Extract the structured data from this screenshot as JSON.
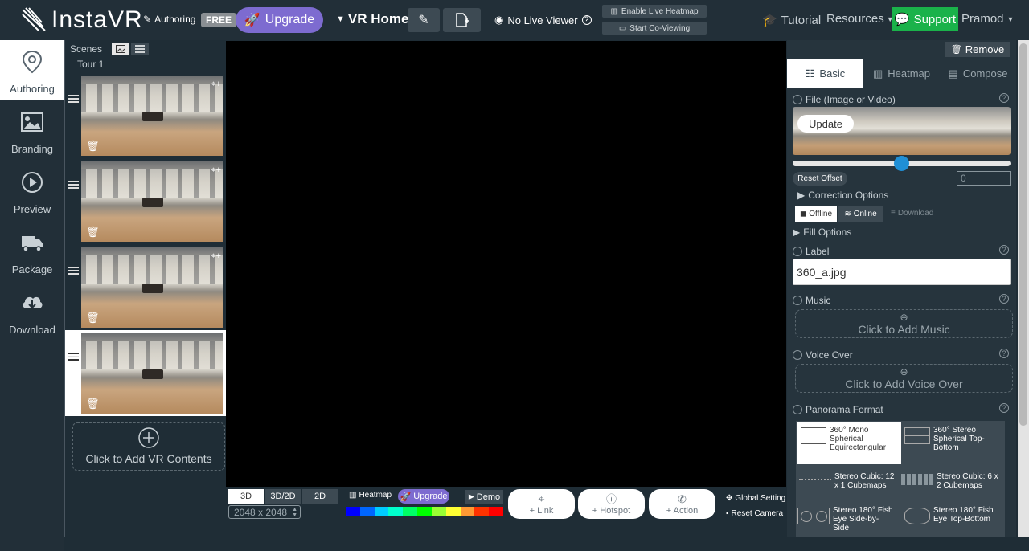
{
  "header": {
    "app_name": "InstaVR",
    "mode_label": "Authoring",
    "plan_badge": "FREE",
    "upgrade_label": "Upgrade",
    "project_title": "VR Home",
    "live_viewer": "No Live Viewer",
    "heatmap_label": "Enable Live Heatmap",
    "coview_label": "Start Co-Viewing",
    "tutorial_label": "Tutorial",
    "resources_label": "Resources",
    "support_label": "Support",
    "user_name": "Pramod"
  },
  "sidebar": {
    "items": [
      {
        "label": "Authoring",
        "icon": "map-pin-icon"
      },
      {
        "label": "Branding",
        "icon": "image-icon"
      },
      {
        "label": "Preview",
        "icon": "play-circle-icon"
      },
      {
        "label": "Package",
        "icon": "truck-icon"
      },
      {
        "label": "Download",
        "icon": "cloud-download-icon"
      }
    ]
  },
  "scenes": {
    "header_label": "Scenes",
    "tour_label": "Tour 1",
    "add_label": "Click to Add VR Contents"
  },
  "viewer": {
    "modes": [
      "3D",
      "3D/2D",
      "2D"
    ],
    "resolution": "2048 x 2048",
    "heatmap_label": "Heatmap",
    "upgrade_label": "Upgrade",
    "demo_label": "Demo",
    "link_label": "+ Link",
    "hotspot_label": "+ Hotspot",
    "action_label": "+ Action",
    "global_settings": "Global Setting",
    "reset_camera": "Reset Camera",
    "heat_colors": [
      "#0000ff",
      "#0066ff",
      "#00ccff",
      "#00ffcc",
      "#00ff66",
      "#00ff00",
      "#99ff33",
      "#ffff33",
      "#ff9933",
      "#ff3300",
      "#ff0000"
    ]
  },
  "right_panel": {
    "remove_label": "Remove",
    "tabs": [
      "Basic",
      "Heatmap",
      "Compose"
    ],
    "file_label": "File (Image or Video)",
    "update_label": "Update",
    "reset_offset_label": "Reset Offset",
    "offset_value": "0",
    "correction_label": "Correction Options",
    "offline_label": "Offline",
    "online_label": "Online",
    "download_label": "Download",
    "fill_label": "Fill Options",
    "label_label": "Label",
    "label_value": "360_a.jpg",
    "music_label": "Music",
    "music_add": "Click to Add Music",
    "voice_label": "Voice Over",
    "voice_add": "Click to Add Voice Over",
    "pano_label": "Panorama Format",
    "formats": [
      "360° Mono Spherical Equirectangular",
      "360° Stereo Spherical Top-Bottom",
      "Stereo Cubic: 12 x 1 Cubemaps",
      "Stereo Cubic: 6 x 2 Cubemaps",
      "Stereo 180° Fish Eye Side-by-Side",
      "Stereo 180° Fish Eye Top-Bottom"
    ]
  },
  "colors": {
    "accent_purple": "#7d6bd0",
    "support_green": "#1ab24a",
    "dark_bg": "#1f2d36",
    "slider_blue": "#1f8fd6"
  }
}
